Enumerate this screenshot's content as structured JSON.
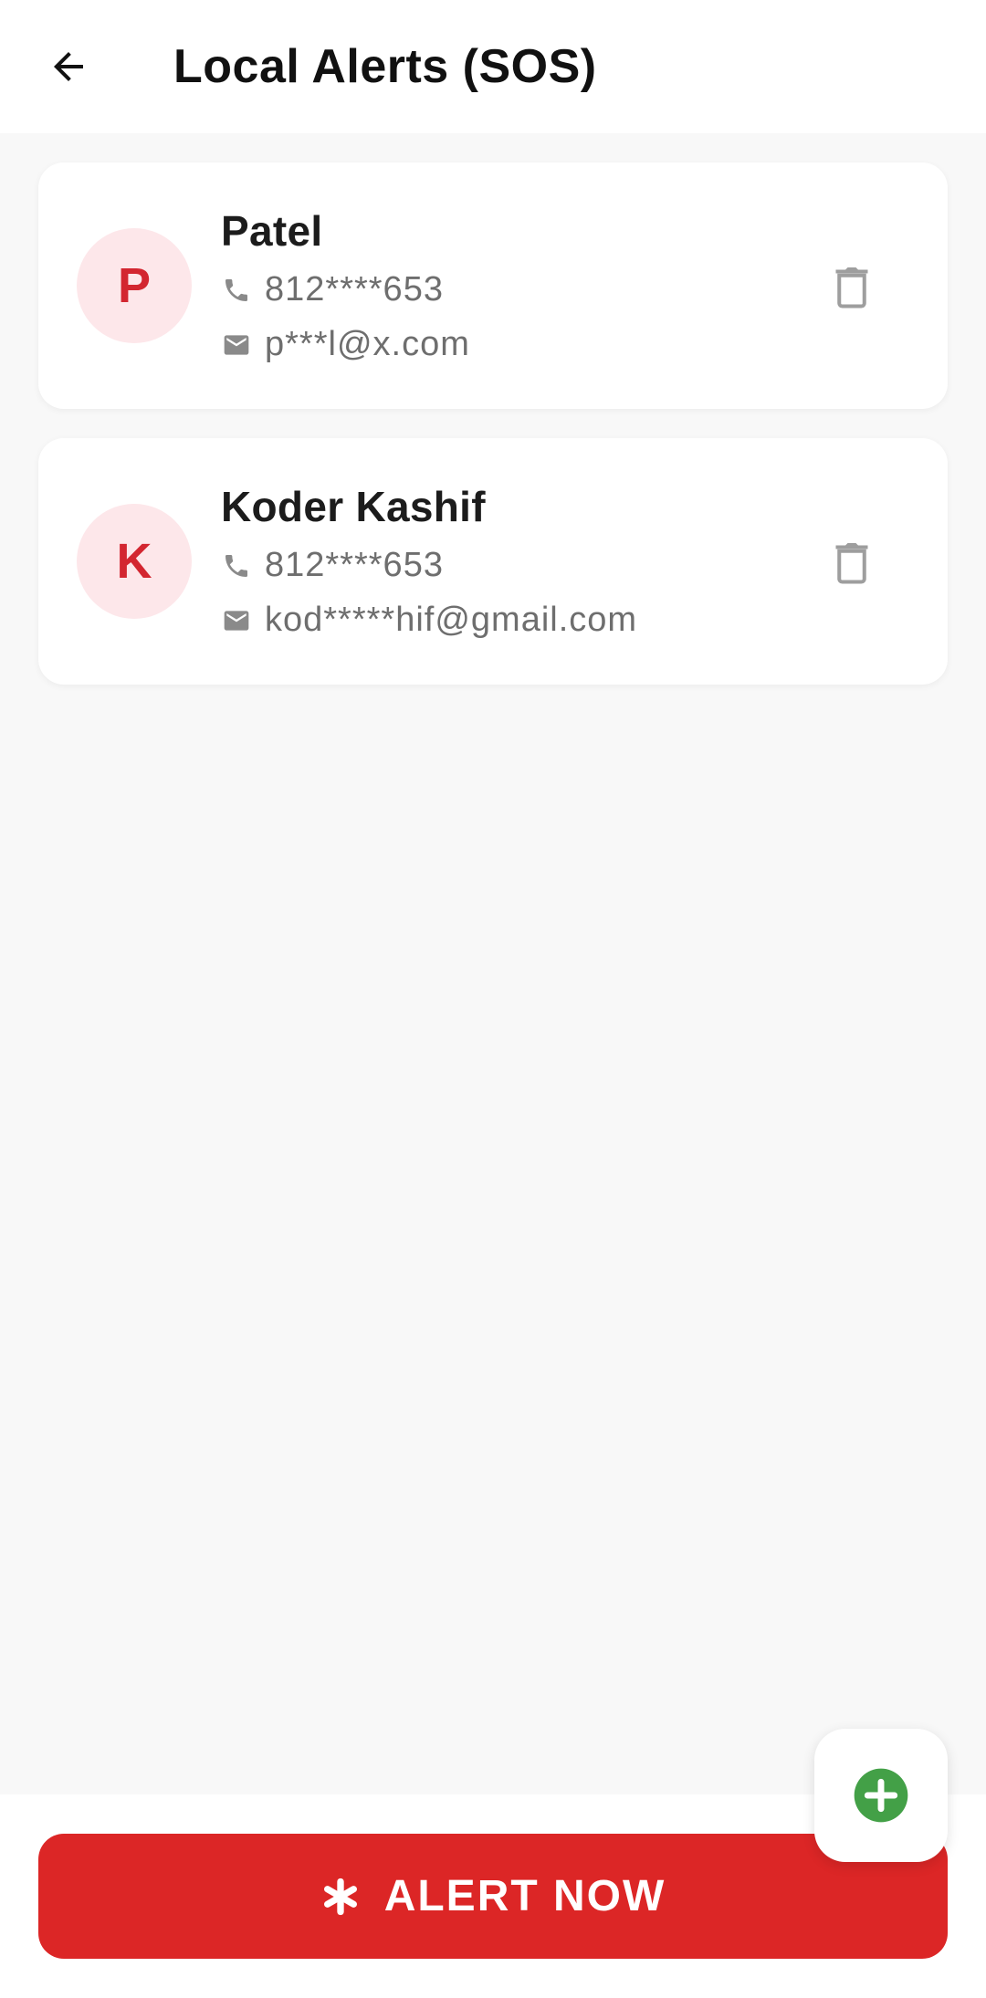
{
  "header": {
    "title": "Local Alerts (SOS)",
    "back_icon": "arrow-left-icon"
  },
  "contacts": [
    {
      "initial": "P",
      "name": "Patel",
      "phone": "812****653",
      "email": "p***l@x.com"
    },
    {
      "initial": "K",
      "name": "Koder Kashif",
      "phone": "812****653",
      "email": "kod*****hif@gmail.com"
    }
  ],
  "actions": {
    "alert_label": "ALERT NOW",
    "add_icon": "plus-circle-icon"
  },
  "colors": {
    "accent_red": "#dc2626",
    "avatar_bg": "#fde7ea",
    "add_green": "#43a047",
    "icon_gray": "#9e9e9e"
  }
}
